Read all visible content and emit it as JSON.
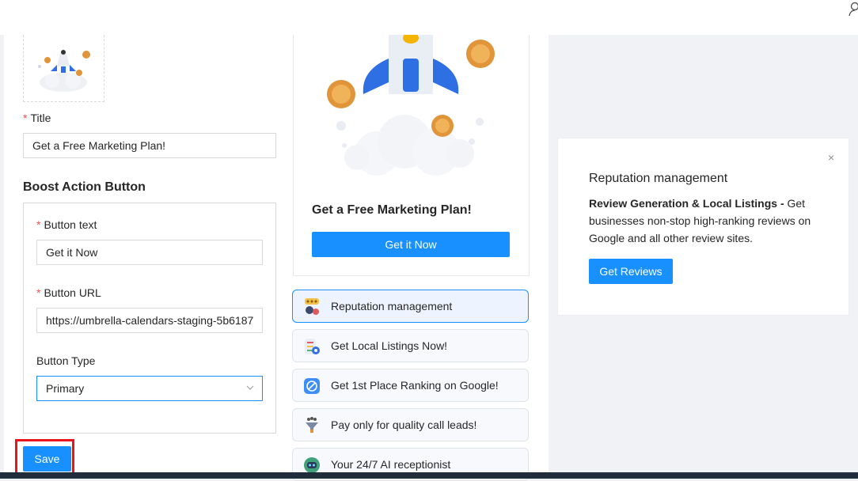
{
  "form": {
    "title_label": "Title",
    "title_value": "Get a Free Marketing Plan!",
    "section_title": "Boost Action Button",
    "button_text_label": "Button text",
    "button_text_value": "Get it Now",
    "button_url_label": "Button URL",
    "button_url_value": "https://umbrella-calendars-staging-5b6187",
    "button_type_label": "Button Type",
    "button_type_value": "Primary",
    "save_label": "Save"
  },
  "preview": {
    "title": "Get a Free Marketing Plan!",
    "button_label": "Get it Now"
  },
  "list": [
    {
      "label": "Reputation management",
      "icon": "reputation-icon"
    },
    {
      "label": "Get Local Listings Now!",
      "icon": "listings-icon"
    },
    {
      "label": "Get 1st Place Ranking on Google!",
      "icon": "ranking-icon"
    },
    {
      "label": "Pay only for quality call leads!",
      "icon": "funnel-icon"
    },
    {
      "label": "Your 24/7 AI receptionist",
      "icon": "robot-icon"
    }
  ],
  "info": {
    "title": "Reputation management",
    "desc_bold": "Review Generation & Local Listings -",
    "desc_rest": " Get businesses non-stop high-ranking reviews on Google and all other review sites.",
    "button_label": "Get Reviews",
    "close": "×"
  },
  "colors": {
    "primary": "#1890ff",
    "required": "#ff4d4f",
    "highlight": "#e8141e"
  }
}
